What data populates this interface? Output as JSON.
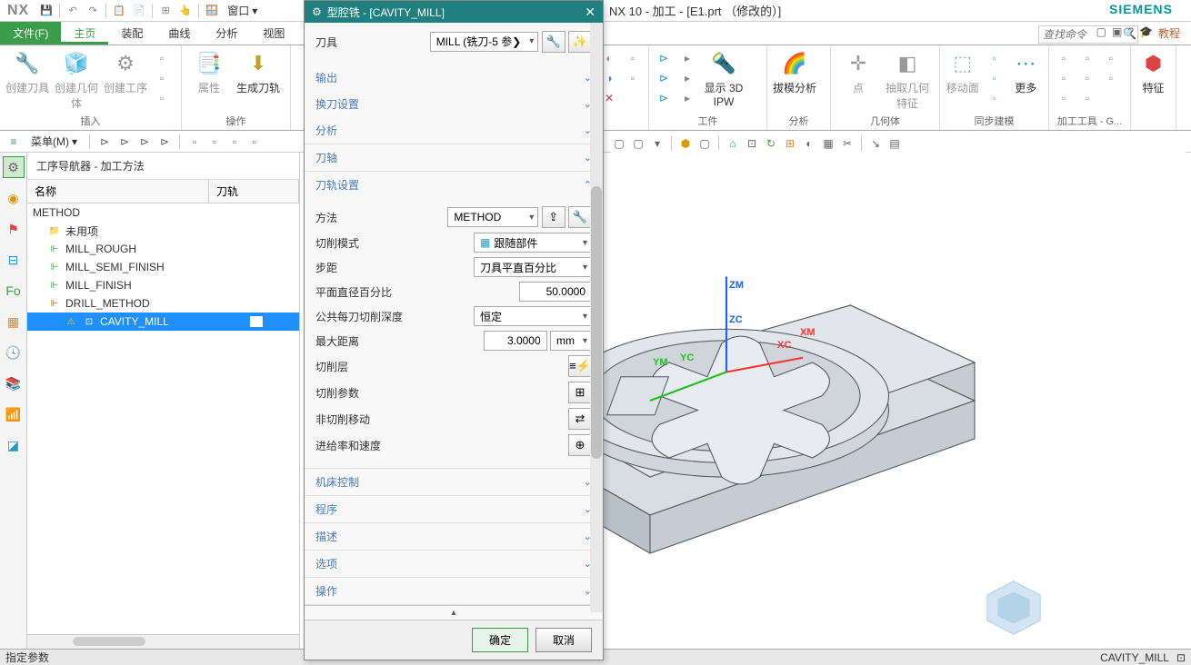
{
  "qat": {
    "window_menu": "窗口"
  },
  "title_bar": "NX 10 - 加工 - [E1.prt （修改的）]",
  "brand": "SIEMENS",
  "nx_logo": "NX",
  "tabs": {
    "file": "文件(F)",
    "home": "主页",
    "assembly": "装配",
    "curve": "曲线",
    "analysis": "分析",
    "view": "视图"
  },
  "search_placeholder": "查找命令",
  "tutorial": "教程",
  "ribbon": {
    "insert": {
      "create_tool": "创建刀具",
      "create_geometry": "创建几何体",
      "create_operation": "创建工序",
      "label": "插入"
    },
    "operation": {
      "properties": "属性",
      "generate_toolpath": "生成刀轨",
      "label": "操作"
    },
    "ipw": {
      "show_3d_ipw": "显示 3D IPW",
      "draft_analysis": "拔模分析",
      "label_workpiece": "工件",
      "label_analysis": "分析"
    },
    "geom": {
      "point": "点",
      "extract_geom": "抽取几何特征",
      "move_face": "移动面",
      "more": "更多",
      "label_geom": "几何体",
      "label_sync": "同步建模"
    },
    "tools": {
      "label": "加工工具 - G...",
      "feature": "特征"
    }
  },
  "menubar": {
    "menu": "菜单(M)"
  },
  "nav": {
    "title": "工序导航器 - 加工方法",
    "col_name": "名称",
    "col_toolpath": "刀轨",
    "root": "METHOD",
    "unused": "未用项",
    "items": [
      "MILL_ROUGH",
      "MILL_SEMI_FINISH",
      "MILL_FINISH",
      "DRILL_METHOD"
    ],
    "selected": "CAVITY_MILL"
  },
  "dialog": {
    "title": "型腔铣 - [CAVITY_MILL]",
    "tool_section": "刀具",
    "tool_value": "MILL (铣刀-5 参❯",
    "output": "输出",
    "tool_change": "换刀设置",
    "analysis": "分析",
    "tool_axis": "刀轴",
    "path_settings": "刀轨设置",
    "method_label": "方法",
    "method_value": "METHOD",
    "cut_pattern_label": "切削模式",
    "cut_pattern_value": "跟随部件",
    "stepover_label": "步距",
    "stepover_value": "刀具平直百分比",
    "flat_dia_label": "平面直径百分比",
    "flat_dia_value": "50.0000",
    "common_depth_label": "公共每刀切削深度",
    "common_depth_value": "恒定",
    "max_dist_label": "最大距离",
    "max_dist_value": "3.0000",
    "max_dist_unit": "mm",
    "cut_levels": "切削层",
    "cut_params": "切削参数",
    "non_cut_moves": "非切削移动",
    "feeds_speeds": "进给率和速度",
    "machine_control": "机床控制",
    "program": "程序",
    "description": "描述",
    "options": "选项",
    "actions": "操作",
    "ok": "确定",
    "cancel": "取消"
  },
  "axes": {
    "zm": "ZM",
    "zc": "ZC",
    "xm": "XM",
    "xc": "XC",
    "ym": "YM",
    "yc": "YC"
  },
  "status": {
    "left": "指定参数",
    "right": "CAVITY_MILL"
  }
}
